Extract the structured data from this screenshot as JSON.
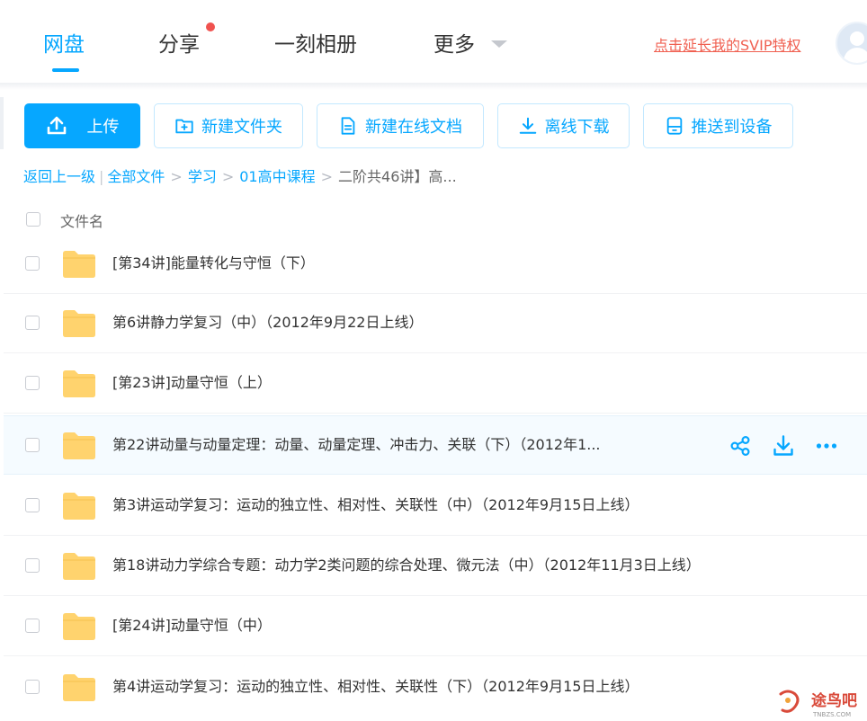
{
  "nav": {
    "tabs": [
      {
        "label": "网盘",
        "active": true
      },
      {
        "label": "分享",
        "active": false
      },
      {
        "label": "一刻相册",
        "active": false
      },
      {
        "label": "更多",
        "active": false
      }
    ],
    "svip_link": "点击延长我的SVIP特权"
  },
  "toolbar": {
    "upload": "上传",
    "new_folder": "新建文件夹",
    "new_doc": "新建在线文档",
    "offline_download": "离线下载",
    "push_device": "推送到设备"
  },
  "breadcrumb": {
    "back": "返回上一级",
    "items": [
      "全部文件",
      "学习",
      "01高中课程"
    ],
    "current": "二阶共46讲】高..."
  },
  "list": {
    "header": "文件名",
    "rows": [
      {
        "name": "[第34讲]能量转化与守恒（下）"
      },
      {
        "name": "第6讲静力学复习（中）（2012年9月22日上线）"
      },
      {
        "name": "[第23讲]动量守恒（上）"
      },
      {
        "name": "第22讲动量与动量定理：动量、动量定理、冲击力、关联（下）（2012年1..."
      },
      {
        "name": "第3讲运动学复习：运动的独立性、相对性、关联性（中）（2012年9月15日上线）"
      },
      {
        "name": "第18讲动力学综合专题：动力学2类问题的综合处理、微元法（中）（2012年11月3日上线）"
      },
      {
        "name": "[第24讲]动量守恒（中）"
      },
      {
        "name": "第4讲运动学复习：运动的独立性、相对性、关联性（下）（2012年9月15日上线）"
      }
    ]
  },
  "watermark": {
    "text": "途鸟吧",
    "sub": "TNBZS.COM"
  },
  "colors": {
    "accent": "#06a7ff",
    "folder": "#ffd36e",
    "svip": "#f06051",
    "badge": "#f0524f"
  }
}
